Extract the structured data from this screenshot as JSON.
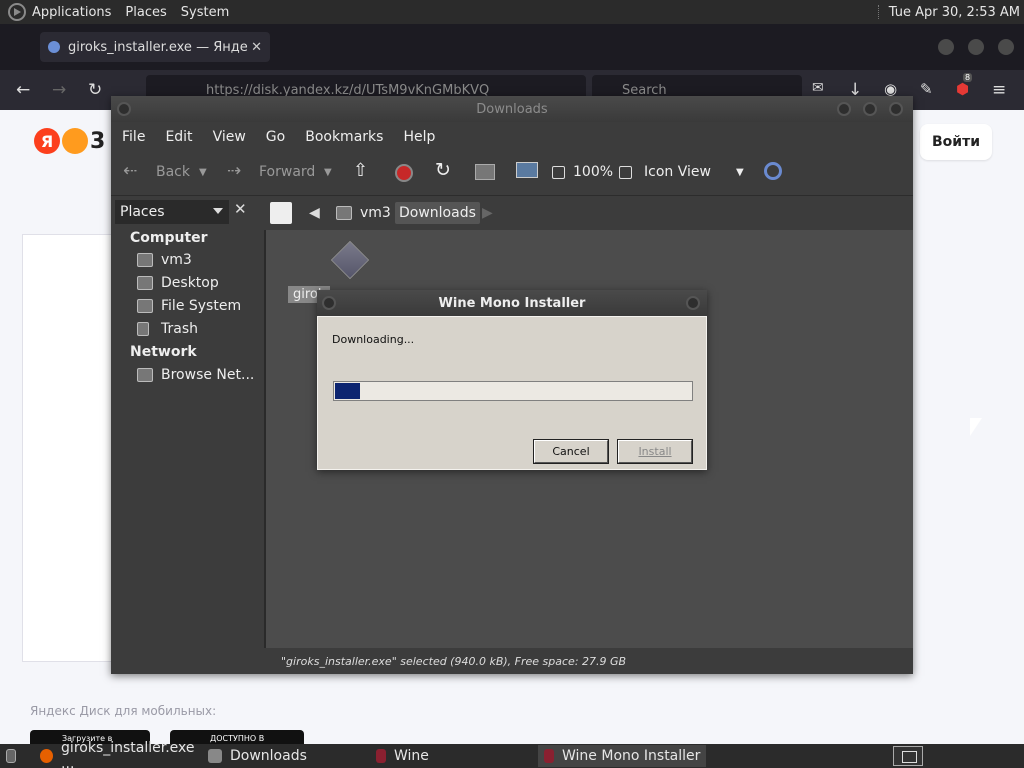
{
  "top_panel": {
    "menus": [
      "Applications",
      "Places",
      "System"
    ],
    "clock": "Tue Apr 30,  2:53 AM"
  },
  "firefox": {
    "tab_title": "giroks_installer.exe — Янде",
    "tab_close": "✕",
    "url": "https://disk.yandex.kz/d/UTsM9vKnGMbKVQ",
    "search_placeholder": "Search",
    "extension_badge": "8",
    "login_button": "Войти",
    "yandex_letter": "Я",
    "disk_letter": "3",
    "mobile_caption": "Яндекс Диск для мобильных:",
    "store_badges": [
      "Загрузите в",
      "ДОСТУПНО В"
    ]
  },
  "downloads_window": {
    "title": "Downloads",
    "menu": [
      "File",
      "Edit",
      "View",
      "Go",
      "Bookmarks",
      "Help"
    ],
    "toolbar": {
      "back": "Back",
      "forward": "Forward",
      "zoom": "100%",
      "view_mode": "Icon View"
    },
    "places_label": "Places",
    "breadcrumbs": [
      "vm3",
      "Downloads"
    ],
    "sidebar": {
      "computer_heading": "Computer",
      "computer_items": [
        "vm3",
        "Desktop",
        "File System",
        "Trash"
      ],
      "network_heading": "Network",
      "network_items": [
        "Browse Net..."
      ]
    },
    "file_label": "girok",
    "status": "\"giroks_installer.exe\" selected (940.0 kB), Free space: 27.9 GB"
  },
  "wine_dialog": {
    "title": "Wine Mono Installer",
    "message": "Downloading...",
    "progress": 0.07,
    "cancel": "Cancel",
    "install": "Install"
  },
  "taskbar": {
    "tasks": [
      "giroks_installer.exe ...",
      "Downloads",
      "Wine",
      "Wine Mono Installer"
    ]
  },
  "colors": {
    "progress_fill": "#0c2470",
    "panel_bg": "#2b2b2b",
    "yandex_red": "#fc3f1d"
  }
}
